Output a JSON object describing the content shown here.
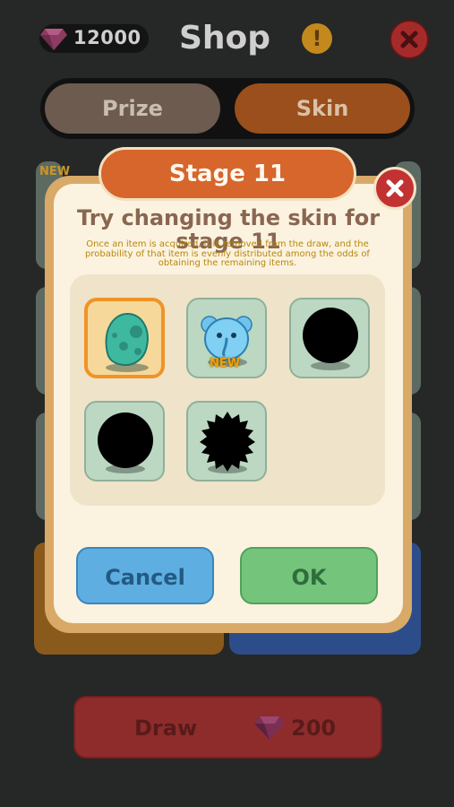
{
  "header": {
    "gem_count": "12000",
    "title": "Shop",
    "info_label": "!",
    "gem_icon": "gem-icon",
    "close_icon": "close-icon"
  },
  "tabs": [
    {
      "label": "Prize",
      "selected": false
    },
    {
      "label": "Skin",
      "selected": true
    }
  ],
  "background_cards": {
    "badge": "NEW"
  },
  "draw": {
    "label": "Draw",
    "cost": "200",
    "icon": "gem-icon"
  },
  "popup": {
    "header": "Stage 11",
    "title": "Try changing the skin for stage 11",
    "description": "Once an item is acquired, it is removed from the draw, and the probability of that item is evenly distributed among the odds of obtaining the remaining items.",
    "skins": [
      {
        "name": "teal-egg-creature",
        "state": "selected",
        "badge": ""
      },
      {
        "name": "blue-elephant",
        "state": "unlocked",
        "badge": "NEW"
      },
      {
        "name": "locked-round-silhouette",
        "state": "locked",
        "badge": ""
      },
      {
        "name": "locked-round-silhouette",
        "state": "locked",
        "badge": ""
      },
      {
        "name": "locked-spiky-silhouette",
        "state": "locked",
        "badge": ""
      }
    ],
    "cancel_label": "Cancel",
    "ok_label": "OK",
    "close_icon": "close-icon"
  },
  "colors": {
    "background": "#262727",
    "popup_frame": "#d9a968",
    "popup_inner": "#fbf3df",
    "header_orange": "#d6662b",
    "cancel_blue": "#5eaee2",
    "ok_green": "#74c47c",
    "close_red": "#c23232"
  }
}
